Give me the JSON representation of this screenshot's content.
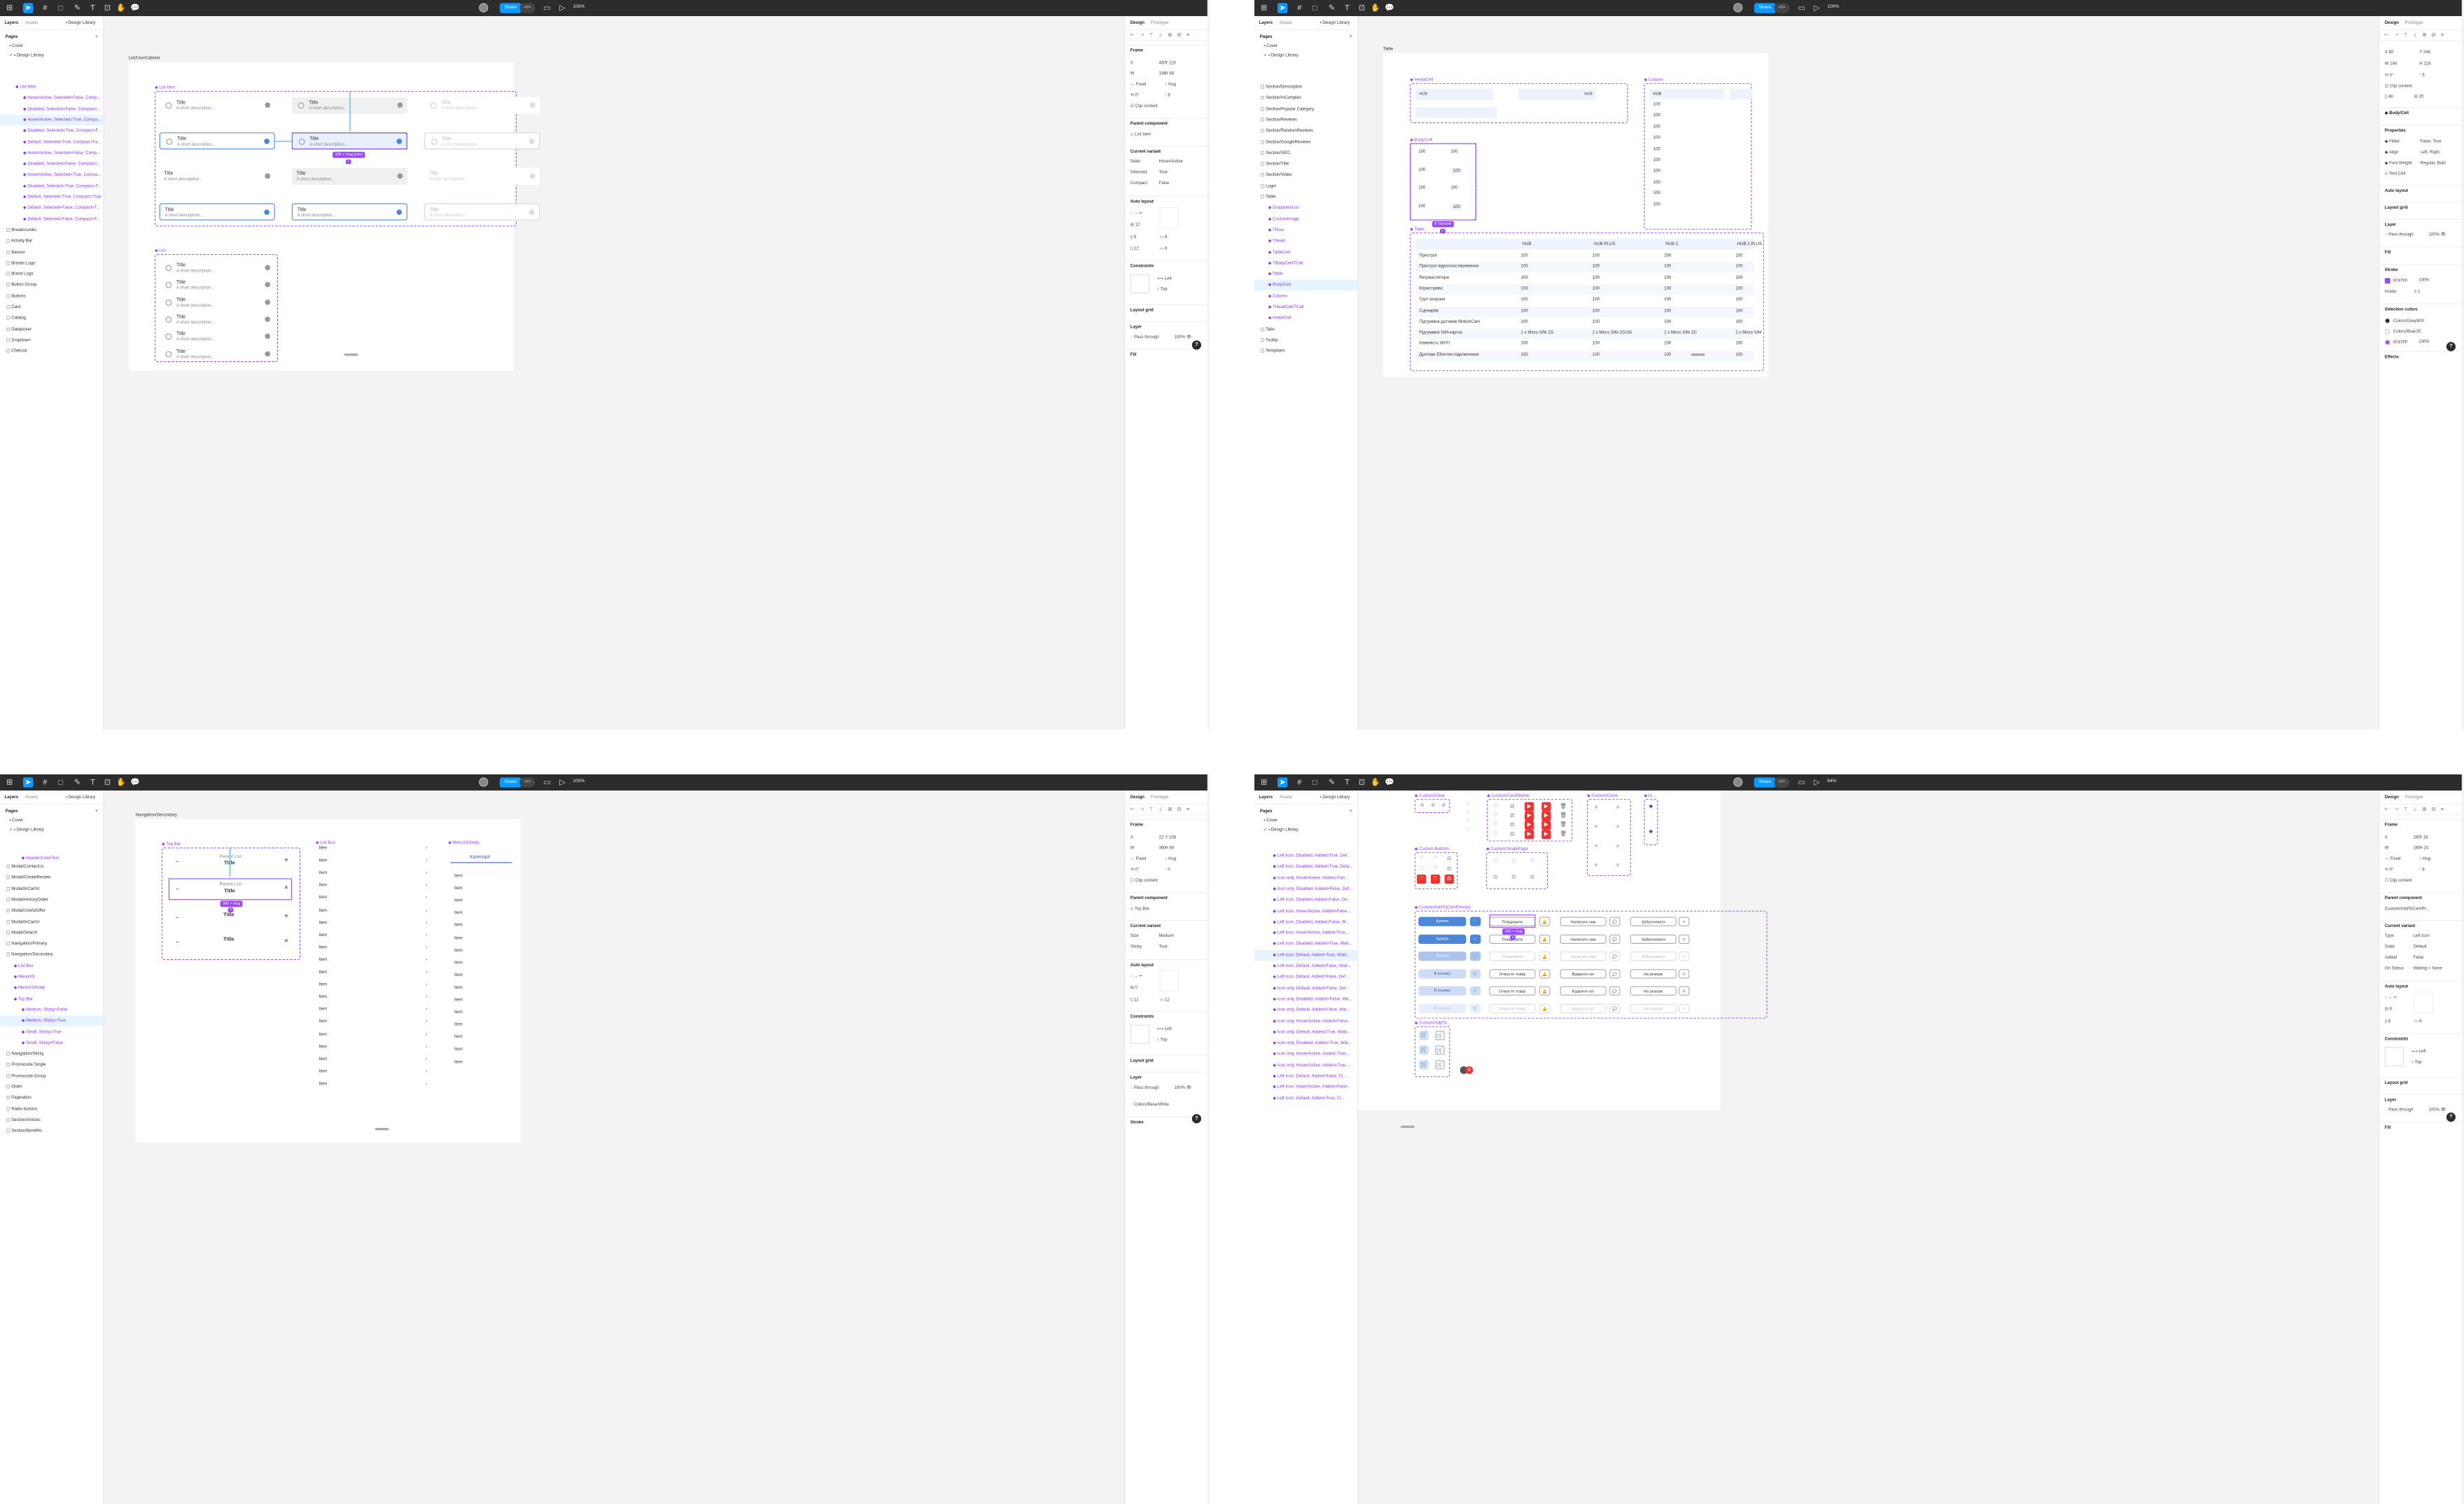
{
  "toolbar": {
    "share": "Share",
    "zoom_a": "100%",
    "zoom_b": "100%",
    "zoom_c": "100%",
    "zoom_d": "84%"
  },
  "left_panel": {
    "tab_layers": "Layers",
    "tab_assets": "Assets",
    "library": "Design Library",
    "pages_title": "Pages",
    "page_cover": "Cover",
    "page_design": "Design Library"
  },
  "right_panel": {
    "tab_design": "Design",
    "tab_prototype": "Prototype"
  },
  "q1": {
    "frame_title": "List/UserCabinet",
    "layers": [
      "List Item",
      "Hover/Active, Selected=False, Comp...",
      "Disabled, Selected=False, Compact=...",
      "Hover/Active, Selected=True, Compa...",
      "Disabled, Selected=True, Compact=F...",
      "Default, Selected=True, Compact=Fa...",
      "Hover/Active, Selected=False, Comp...",
      "Disabled, Selected=False, Compact=...",
      "Hover/Active, Selected=True, Compa...",
      "Disabled, Selected=True, Compact=T...",
      "Default, Selected=True, Compact=True",
      "Default, Selected=False, Compact=T...",
      "Default, Selected=False, Compact=F...",
      "Breadcrumbs",
      "Activity Bar",
      "Banner",
      "Brands Logo",
      "Brand Logo",
      "Button Group",
      "Buttons",
      "Card",
      "Catalog",
      "Datepicker",
      "Dropdown",
      "Chekout"
    ],
    "list_item_label": "List Item",
    "list_label": "List",
    "card_title": "Title",
    "card_desc": "A short description...",
    "size_badge": "336 × Hug (min)",
    "props": {
      "frame": "Frame",
      "x": "400",
      "y": "120",
      "w": "336",
      "h": "68",
      "fixed": "Fixed",
      "hug": "Hug",
      "rot": "0°",
      "rad": "8",
      "clip": "Clip content",
      "parent": "Parent component",
      "parent_name": "List Item",
      "current_variant": "Current variant",
      "state_k": "State",
      "state_v": "Hover/Active",
      "sel_k": "Selected",
      "sel_v": "True",
      "comp_k": "Compact",
      "comp_v": "False",
      "auto": "Auto layout",
      "g1": "12",
      "p1": "8",
      "p2": "6",
      "p3": "12",
      "p4": "6",
      "constraints": "Constraints",
      "left": "Left",
      "top": "Top",
      "grid": "Layout grid",
      "layer": "Layer",
      "pass": "Pass through",
      "op": "100%",
      "fill": "Fill"
    }
  },
  "q2": {
    "frame_title": "Table",
    "layers": [
      "Section/Description",
      "Section/InComplex",
      "Section/Popular Category",
      "Section/Reviews",
      "Section/RandomReviews",
      "Section/GoogleReviews",
      "Section/SEO",
      "Section/Title",
      "Section/Video",
      "Login",
      "Table",
      "DropdownList",
      "CustomImage",
      "TRow",
      "Thead",
      "TableCell",
      "TBodyCell/TCell",
      "Table",
      "Body/Cell",
      "Column",
      "THeadCell/TCell",
      "Head/Cell",
      "Tabs",
      "Tooltip",
      "Templates"
    ],
    "head_cell": "Head/Cell",
    "column": "Column",
    "body_cell": "Body/Cell",
    "table": "Table",
    "variants": "8 Variants",
    "hub": "HUB",
    "v100": "100",
    "headers": [
      "HUB",
      "HUB PLUS",
      "HUB 2",
      "HUB 2 PLUS"
    ],
    "rows": [
      {
        "name": "Пристрої",
        "vals": [
          "100",
          "100",
          "100",
          "100"
        ]
      },
      {
        "name": "Пристрої відеоспостереження",
        "vals": [
          "100",
          "100",
          "100",
          "100"
        ]
      },
      {
        "name": "Ретранслятори",
        "vals": [
          "100",
          "100",
          "100",
          "100"
        ]
      },
      {
        "name": "Користувачі",
        "vals": [
          "100",
          "100",
          "100",
          "100"
        ]
      },
      {
        "name": "Груп охорони",
        "vals": [
          "100",
          "100",
          "100",
          "100"
        ]
      },
      {
        "name": "Сценаріїв",
        "vals": [
          "100",
          "100",
          "100",
          "100"
        ]
      },
      {
        "name": "Підтримка датчиків MotionCam",
        "vals": [
          "100",
          "100",
          "100",
          "100"
        ]
      },
      {
        "name": "Підтримка SIM-карток",
        "vals": [
          "1 x Micro SIM 2G",
          "2 x Micro SIM 2G/3G",
          "2 x Micro SIM 2G",
          "2 x Micro SIM"
        ]
      },
      {
        "name": "Наявність Wi-Fi",
        "vals": [
          "100",
          "100",
          "100",
          "100"
        ]
      },
      {
        "name": "Дротове Ethernet-підключення",
        "vals": [
          "100",
          "100",
          "100",
          "100"
        ]
      }
    ],
    "props": {
      "x": "80",
      "y": "248",
      "w": "194",
      "h": "224",
      "rot": "0°",
      "rad": "5",
      "clip": "Clip content",
      "p1": "48",
      "p2": "20",
      "inst": "Body/Cell",
      "properties": "Properties",
      "filled_k": "Filled",
      "filled_v": "False, True",
      "align_k": "Align",
      "align_v": "Left, Right",
      "fw_k": "Font Weight",
      "fw_v": "Regular, Bold",
      "text_k": "Text Cell",
      "auto": "Auto layout",
      "grid": "Layout grid",
      "layer": "Layer",
      "pass": "Pass through",
      "op": "100%",
      "fill": "Fill",
      "stroke": "Stroke",
      "stroke_hex": "9747FF",
      "stroke_op": "100%",
      "inside": "Inside",
      "sw": "1",
      "selcol": "Selection colors",
      "c1": "Colors/Grey/800",
      "c2": "Colors/Blue/25",
      "c3": "9747FF",
      "c3op": "100%",
      "effects": "Effects"
    }
  },
  "q3": {
    "frame_title": "Navigation/Secondary",
    "layers": [
      "Modal/ContactUs",
      "Modal/CreateReview",
      "Modal/InCartVr",
      "Modal/HistoryOrder",
      "Modal/UsefulOffer",
      "Modal/InCartVr",
      "Modal/Search",
      "Navigation/Primary",
      "Navigation/Secondary",
      "List Box",
      "MenuXS",
      "MenuXS/body",
      "Top Bar",
      "Medium, Sticky=False",
      "Medium, Sticky=True",
      "Small, Sticky=True",
      "Small, Sticky=False",
      "Navigation/Sticky",
      "Promocode Single",
      "Promocode Group",
      "Order",
      "Pagination",
      "Radio buttons",
      "Section/Articles",
      "Section/Benefits"
    ],
    "top_bar": "Top Bar",
    "list_box": "List Box",
    "menu_body": "MenuXS/body",
    "parent_list": "Parent List",
    "title": "Title",
    "item": "Item",
    "kategorii": "Категорії",
    "size_badge": "360 × Hug",
    "props": {
      "frame": "Frame",
      "x": "22",
      "y": "108",
      "w": "360",
      "h": "60",
      "fixed": "Fixed",
      "hug": "Hug",
      "rot": "0°",
      "rad": "0",
      "clip": "Clip content",
      "parent": "Parent component",
      "parent_name": "Top Bar",
      "current_variant": "Current variant",
      "size_k": "Size",
      "size_v": "Medium",
      "sticky_k": "Sticky",
      "sticky_v": "True",
      "auto": "Auto layout",
      "g1": "0",
      "p1": "12",
      "p2": "12",
      "constraints": "Constraints",
      "left": "Left",
      "top": "Top",
      "grid": "Layout grid",
      "layer": "Layer",
      "pass": "Pass through",
      "op": "100%",
      "fillname": "Colors/Base/White",
      "stroke": "Stroke"
    }
  },
  "q4": {
    "layers": [
      "Left Icon, Disabled, Added=True, Def...",
      "Left Icon, Disabled, Added=True, Defa...",
      "Icon only, Hover/Active, Added=Fals...",
      "Icon only, Disabled, Added=False, Def...",
      "Left Icon, Disabled, Added=False, De...",
      "Left Icon, Hover/Active, Added=False...",
      "Left Icon, Disabled, Added=False, W...",
      "Left Icon, Hover/Active, Added=True,...",
      "Left Icon, Disabled, Added=True, Wait...",
      "Left Icon, Default, Added=True, Waiti...",
      "Left Icon, Default, Added=False, Wait...",
      "Left Icon, Default, Added=False, Def...",
      "Icon only, Default, Added=False, Def...",
      "Icon only, Disabled, Added=False, Wa...",
      "Icon only, Default, Added=False, Wai...",
      "Icon only, Hover/Active, Added=False...",
      "Icon only, Default, Added=True, Waiti...",
      "Icon only, Disabled, Added=True, Wai...",
      "Icon only, Hover/Active, Added=True,...",
      "Icon only, Hover/Active, Added=True,...",
      "Left Icon, Default, Added=False, Cl...",
      "Left Icon, Hover/Active, Added=False...",
      "Left Icon, Default, Added=True, Cl..."
    ],
    "custom_clear": "Custom/Clear",
    "card_button": "Custom/Card/Button",
    "custom_close": "Custom/Close",
    "custom_in": "In...",
    "custom_buttons": "Custom Buttons",
    "single_page": "Custom/SinglePage",
    "add_to_cart_primary": "Custom/AddToCart/Primary",
    "add_to": "Custom/AddTo...",
    "size_badge": "160 × Hug",
    "btns": {
      "buy": "Купити",
      "tocart": "В кошику",
      "notify": "Повідомити",
      "write": "Написати нам",
      "reserve": "Забронювати",
      "price": "Дізнатись ціну",
      "wait": "Очікуєте товар",
      "chat": "Відкрити чат",
      "onres": "На резерві"
    },
    "props": {
      "frame": "Frame",
      "x": "260",
      "y": "16",
      "w": "160",
      "h": "24",
      "fixed": "Fixed",
      "hug": "Hug",
      "rot": "0°",
      "rad": "8",
      "clip": "Clip content",
      "parent": "Parent component",
      "parent_name": "Custom/AddToCart/Pr...",
      "current_variant": "Current variant",
      "type_k": "Type",
      "type_v": "Left Icon",
      "state_k": "State",
      "state_v": "Default",
      "added_k": "Added",
      "added_v": "False",
      "on_k": "On Status",
      "on_v": "Waiting + None",
      "auto": "Auto layout",
      "g1": "8",
      "p1": "8",
      "p2": "8",
      "constraints": "Constraints",
      "left": "Left",
      "top": "Top",
      "grid": "Layout grid",
      "layer": "Layer",
      "pass": "Pass through",
      "op": "100%",
      "fill": "Fill"
    }
  }
}
